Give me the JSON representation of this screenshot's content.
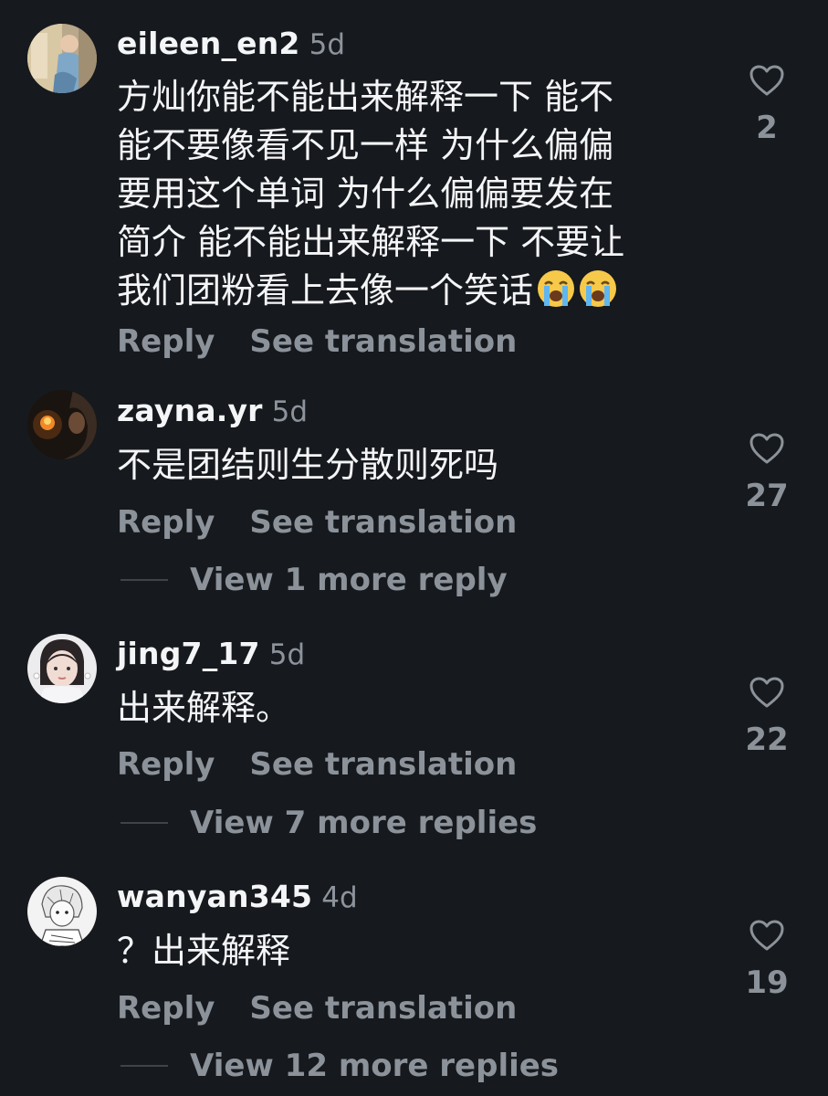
{
  "comments": [
    {
      "username": "eileen_en2",
      "age": "5d",
      "lines": [
        "方灿你能不能出来解释一下 能不",
        "能不要像看不见一样 为什么偏偏",
        "要用这个单词 为什么偏偏要发在",
        "简介 能不能出来解释一下 不要让",
        "我们团粉看上去像一个笑话"
      ],
      "emoji": [
        "crying-face",
        "crying-face"
      ],
      "reply_label": "Reply",
      "translate_label": "See translation",
      "likes": "2",
      "more_replies": ""
    },
    {
      "username": "zayna.yr",
      "age": "5d",
      "lines": [
        "不是团结则生分散则死吗"
      ],
      "reply_label": "Reply",
      "translate_label": "See translation",
      "likes": "27",
      "more_replies": "View 1 more reply"
    },
    {
      "username": "jing7_17",
      "age": "5d",
      "lines": [
        "出来解释。"
      ],
      "reply_label": "Reply",
      "translate_label": "See translation",
      "likes": "22",
      "more_replies": "View 7 more replies"
    },
    {
      "username": "wanyan345",
      "age": "4d",
      "lines": [
        "？出来解释"
      ],
      "reply_label": "Reply",
      "translate_label": "See translation",
      "likes": "19",
      "more_replies": "View 12 more replies"
    }
  ],
  "icons": {
    "like": "heart-outline-icon",
    "emoji": "loudly-crying-face"
  },
  "colors": {
    "background": "#16191d",
    "primary_text": "#f4f5f7",
    "secondary_text": "#8c929a",
    "divider": "#3f444b"
  }
}
